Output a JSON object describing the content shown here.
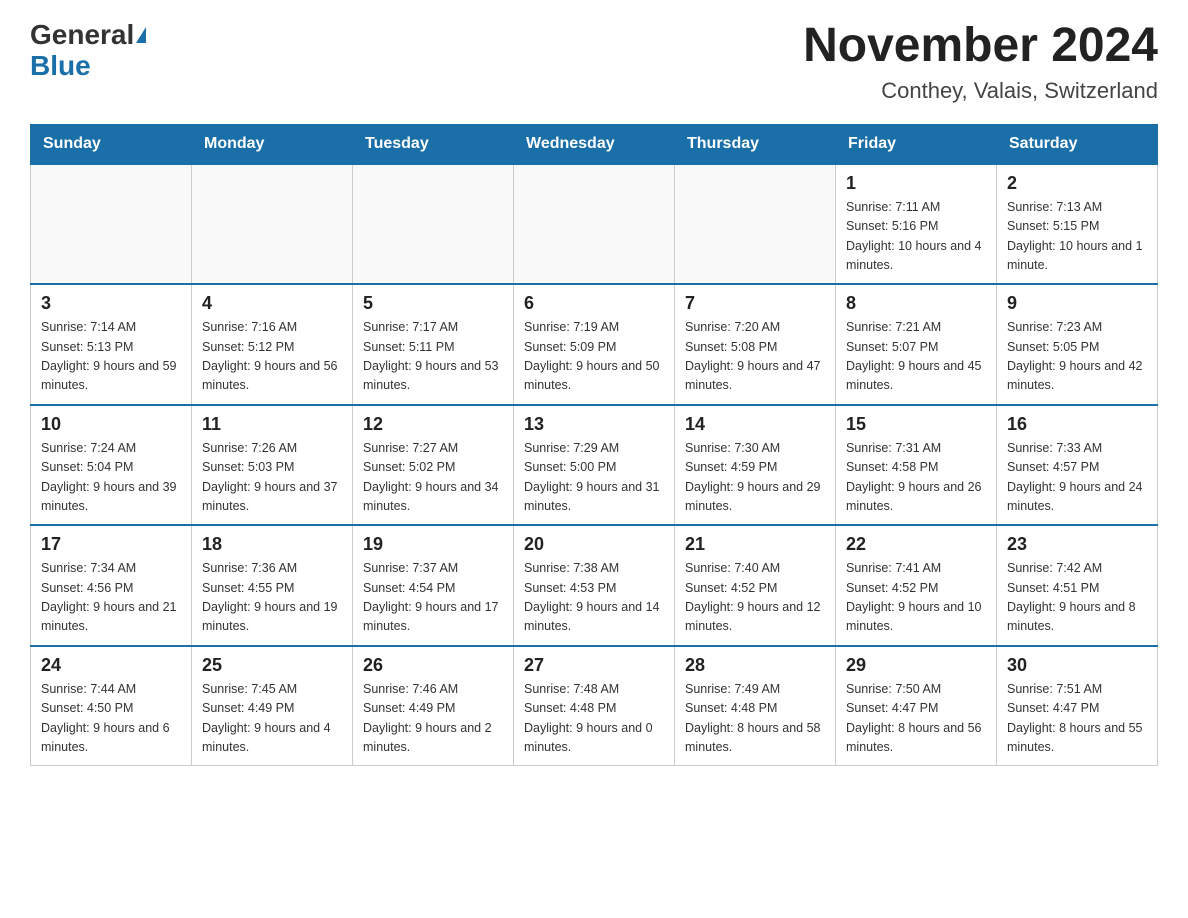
{
  "header": {
    "logo_general": "General",
    "logo_blue": "Blue",
    "month_year": "November 2024",
    "location": "Conthey, Valais, Switzerland"
  },
  "weekdays": [
    "Sunday",
    "Monday",
    "Tuesday",
    "Wednesday",
    "Thursday",
    "Friday",
    "Saturday"
  ],
  "weeks": [
    [
      {
        "day": "",
        "sunrise": "",
        "sunset": "",
        "daylight": ""
      },
      {
        "day": "",
        "sunrise": "",
        "sunset": "",
        "daylight": ""
      },
      {
        "day": "",
        "sunrise": "",
        "sunset": "",
        "daylight": ""
      },
      {
        "day": "",
        "sunrise": "",
        "sunset": "",
        "daylight": ""
      },
      {
        "day": "",
        "sunrise": "",
        "sunset": "",
        "daylight": ""
      },
      {
        "day": "1",
        "sunrise": "Sunrise: 7:11 AM",
        "sunset": "Sunset: 5:16 PM",
        "daylight": "Daylight: 10 hours and 4 minutes."
      },
      {
        "day": "2",
        "sunrise": "Sunrise: 7:13 AM",
        "sunset": "Sunset: 5:15 PM",
        "daylight": "Daylight: 10 hours and 1 minute."
      }
    ],
    [
      {
        "day": "3",
        "sunrise": "Sunrise: 7:14 AM",
        "sunset": "Sunset: 5:13 PM",
        "daylight": "Daylight: 9 hours and 59 minutes."
      },
      {
        "day": "4",
        "sunrise": "Sunrise: 7:16 AM",
        "sunset": "Sunset: 5:12 PM",
        "daylight": "Daylight: 9 hours and 56 minutes."
      },
      {
        "day": "5",
        "sunrise": "Sunrise: 7:17 AM",
        "sunset": "Sunset: 5:11 PM",
        "daylight": "Daylight: 9 hours and 53 minutes."
      },
      {
        "day": "6",
        "sunrise": "Sunrise: 7:19 AM",
        "sunset": "Sunset: 5:09 PM",
        "daylight": "Daylight: 9 hours and 50 minutes."
      },
      {
        "day": "7",
        "sunrise": "Sunrise: 7:20 AM",
        "sunset": "Sunset: 5:08 PM",
        "daylight": "Daylight: 9 hours and 47 minutes."
      },
      {
        "day": "8",
        "sunrise": "Sunrise: 7:21 AM",
        "sunset": "Sunset: 5:07 PM",
        "daylight": "Daylight: 9 hours and 45 minutes."
      },
      {
        "day": "9",
        "sunrise": "Sunrise: 7:23 AM",
        "sunset": "Sunset: 5:05 PM",
        "daylight": "Daylight: 9 hours and 42 minutes."
      }
    ],
    [
      {
        "day": "10",
        "sunrise": "Sunrise: 7:24 AM",
        "sunset": "Sunset: 5:04 PM",
        "daylight": "Daylight: 9 hours and 39 minutes."
      },
      {
        "day": "11",
        "sunrise": "Sunrise: 7:26 AM",
        "sunset": "Sunset: 5:03 PM",
        "daylight": "Daylight: 9 hours and 37 minutes."
      },
      {
        "day": "12",
        "sunrise": "Sunrise: 7:27 AM",
        "sunset": "Sunset: 5:02 PM",
        "daylight": "Daylight: 9 hours and 34 minutes."
      },
      {
        "day": "13",
        "sunrise": "Sunrise: 7:29 AM",
        "sunset": "Sunset: 5:00 PM",
        "daylight": "Daylight: 9 hours and 31 minutes."
      },
      {
        "day": "14",
        "sunrise": "Sunrise: 7:30 AM",
        "sunset": "Sunset: 4:59 PM",
        "daylight": "Daylight: 9 hours and 29 minutes."
      },
      {
        "day": "15",
        "sunrise": "Sunrise: 7:31 AM",
        "sunset": "Sunset: 4:58 PM",
        "daylight": "Daylight: 9 hours and 26 minutes."
      },
      {
        "day": "16",
        "sunrise": "Sunrise: 7:33 AM",
        "sunset": "Sunset: 4:57 PM",
        "daylight": "Daylight: 9 hours and 24 minutes."
      }
    ],
    [
      {
        "day": "17",
        "sunrise": "Sunrise: 7:34 AM",
        "sunset": "Sunset: 4:56 PM",
        "daylight": "Daylight: 9 hours and 21 minutes."
      },
      {
        "day": "18",
        "sunrise": "Sunrise: 7:36 AM",
        "sunset": "Sunset: 4:55 PM",
        "daylight": "Daylight: 9 hours and 19 minutes."
      },
      {
        "day": "19",
        "sunrise": "Sunrise: 7:37 AM",
        "sunset": "Sunset: 4:54 PM",
        "daylight": "Daylight: 9 hours and 17 minutes."
      },
      {
        "day": "20",
        "sunrise": "Sunrise: 7:38 AM",
        "sunset": "Sunset: 4:53 PM",
        "daylight": "Daylight: 9 hours and 14 minutes."
      },
      {
        "day": "21",
        "sunrise": "Sunrise: 7:40 AM",
        "sunset": "Sunset: 4:52 PM",
        "daylight": "Daylight: 9 hours and 12 minutes."
      },
      {
        "day": "22",
        "sunrise": "Sunrise: 7:41 AM",
        "sunset": "Sunset: 4:52 PM",
        "daylight": "Daylight: 9 hours and 10 minutes."
      },
      {
        "day": "23",
        "sunrise": "Sunrise: 7:42 AM",
        "sunset": "Sunset: 4:51 PM",
        "daylight": "Daylight: 9 hours and 8 minutes."
      }
    ],
    [
      {
        "day": "24",
        "sunrise": "Sunrise: 7:44 AM",
        "sunset": "Sunset: 4:50 PM",
        "daylight": "Daylight: 9 hours and 6 minutes."
      },
      {
        "day": "25",
        "sunrise": "Sunrise: 7:45 AM",
        "sunset": "Sunset: 4:49 PM",
        "daylight": "Daylight: 9 hours and 4 minutes."
      },
      {
        "day": "26",
        "sunrise": "Sunrise: 7:46 AM",
        "sunset": "Sunset: 4:49 PM",
        "daylight": "Daylight: 9 hours and 2 minutes."
      },
      {
        "day": "27",
        "sunrise": "Sunrise: 7:48 AM",
        "sunset": "Sunset: 4:48 PM",
        "daylight": "Daylight: 9 hours and 0 minutes."
      },
      {
        "day": "28",
        "sunrise": "Sunrise: 7:49 AM",
        "sunset": "Sunset: 4:48 PM",
        "daylight": "Daylight: 8 hours and 58 minutes."
      },
      {
        "day": "29",
        "sunrise": "Sunrise: 7:50 AM",
        "sunset": "Sunset: 4:47 PM",
        "daylight": "Daylight: 8 hours and 56 minutes."
      },
      {
        "day": "30",
        "sunrise": "Sunrise: 7:51 AM",
        "sunset": "Sunset: 4:47 PM",
        "daylight": "Daylight: 8 hours and 55 minutes."
      }
    ]
  ]
}
